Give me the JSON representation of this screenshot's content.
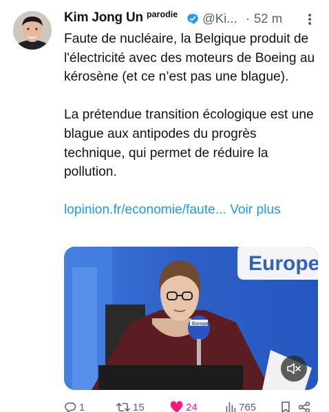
{
  "author": {
    "name": "Kim Jong Un",
    "label": "parodie",
    "handle": "@Ki...",
    "separator": "·",
    "time": "52 m"
  },
  "tweet": {
    "paragraph1": "Faute de nucléaire, la Belgique produit de l'électricité avec des moteurs de Boeing au kérosène (et ce n’est pas une blague).",
    "paragraph2": "La prétendue transition écologique est une blague aux antipodes du progrès technique, qui permet de réduire la pollution.",
    "link": "lopinion.fr/economie/faute...",
    "more_label": "Voir plus"
  },
  "media": {
    "studio_sign": "Europe",
    "mic_flag": "Europe"
  },
  "actions": {
    "replies": "1",
    "retweets": "15",
    "likes": "24",
    "views": "765"
  },
  "colors": {
    "accent": "#1d9bf0",
    "like": "#f91880",
    "muted": "#536471"
  }
}
